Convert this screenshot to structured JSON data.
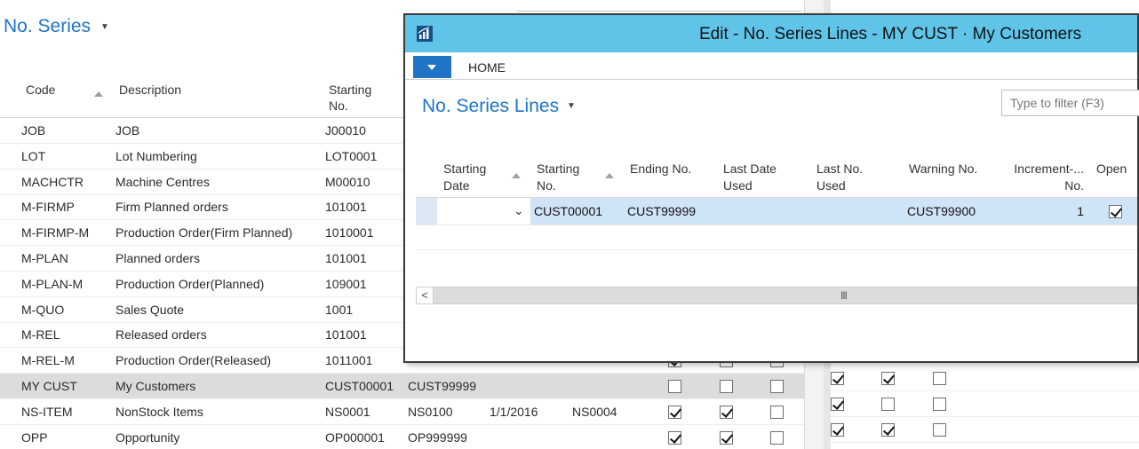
{
  "background_page": {
    "title": "No. Series",
    "columns": {
      "code": "Code",
      "description": "Description",
      "starting_no": "Starting No."
    },
    "rows": [
      {
        "code": "JOB",
        "description": "JOB",
        "starting_no": "J00010",
        "ending_no": "",
        "last_date": "",
        "last_no": "",
        "c1": null,
        "c2": null,
        "c3": null
      },
      {
        "code": "LOT",
        "description": "Lot Numbering",
        "starting_no": "LOT0001",
        "ending_no": "",
        "last_date": "",
        "last_no": "",
        "c1": null,
        "c2": null,
        "c3": null
      },
      {
        "code": "MACHCTR",
        "description": "Machine Centres",
        "starting_no": "M00010",
        "ending_no": "",
        "last_date": "",
        "last_no": "",
        "c1": null,
        "c2": null,
        "c3": null
      },
      {
        "code": "M-FIRMP",
        "description": "Firm Planned orders",
        "starting_no": "101001",
        "ending_no": "",
        "last_date": "",
        "last_no": "",
        "c1": null,
        "c2": null,
        "c3": null
      },
      {
        "code": "M-FIRMP-M",
        "description": "Production Order(Firm Planned)",
        "starting_no": "1010001",
        "ending_no": "",
        "last_date": "",
        "last_no": "",
        "c1": null,
        "c2": null,
        "c3": null
      },
      {
        "code": "M-PLAN",
        "description": "Planned orders",
        "starting_no": "101001",
        "ending_no": "",
        "last_date": "",
        "last_no": "",
        "c1": null,
        "c2": null,
        "c3": null
      },
      {
        "code": "M-PLAN-M",
        "description": "Production Order(Planned)",
        "starting_no": "109001",
        "ending_no": "",
        "last_date": "",
        "last_no": "",
        "c1": null,
        "c2": null,
        "c3": null
      },
      {
        "code": "M-QUO",
        "description": "Sales Quote",
        "starting_no": "1001",
        "ending_no": "",
        "last_date": "",
        "last_no": "",
        "c1": null,
        "c2": null,
        "c3": null
      },
      {
        "code": "M-REL",
        "description": "Released orders",
        "starting_no": "101001",
        "ending_no": "",
        "last_date": "",
        "last_no": "",
        "c1": null,
        "c2": null,
        "c3": null
      },
      {
        "code": "M-REL-M",
        "description": "Production Order(Released)",
        "starting_no": "1011001",
        "ending_no": "",
        "last_date": "",
        "last_no": "",
        "c1": true,
        "c2": false,
        "c3": false
      },
      {
        "code": "MY CUST",
        "description": "My Customers",
        "starting_no": "CUST00001",
        "ending_no": "CUST99999",
        "last_date": "",
        "last_no": "",
        "c1": false,
        "c2": false,
        "c3": false,
        "selected": true
      },
      {
        "code": "NS-ITEM",
        "description": "NonStock Items",
        "starting_no": "NS0001",
        "ending_no": "NS0100",
        "last_date": "1/1/2016",
        "last_no": "NS0004",
        "c1": true,
        "c2": true,
        "c3": false
      },
      {
        "code": "OPP",
        "description": "Opportunity",
        "starting_no": "OP000001",
        "ending_no": "OP999999",
        "last_date": "",
        "last_no": "",
        "c1": true,
        "c2": true,
        "c3": false
      }
    ],
    "right_strip_rows": [
      {
        "c1": true,
        "c2": true,
        "c3": false
      },
      {
        "c1": true,
        "c2": false,
        "c3": false
      },
      {
        "c1": true,
        "c2": true,
        "c3": false
      }
    ]
  },
  "dialog": {
    "title": "Edit - No. Series Lines - MY CUST · My Customers",
    "ribbon_tab": "HOME",
    "page_title": "No. Series Lines",
    "filter_placeholder": "Type to filter (F3)",
    "columns": {
      "starting_date": [
        "Starting",
        "Date"
      ],
      "starting_no": [
        "Starting",
        "No."
      ],
      "ending_no": "Ending No.",
      "last_date_used": [
        "Last Date",
        "Used"
      ],
      "last_no_used": [
        "Last No.",
        "Used"
      ],
      "warning_no": "Warning No.",
      "increment_by_no": [
        "Increment-...",
        "No."
      ],
      "open": "Open"
    },
    "row": {
      "starting_date": "",
      "starting_no": "CUST00001",
      "ending_no": "CUST99999",
      "last_date_used": "",
      "last_no_used": "",
      "warning_no": "CUST99900",
      "increment_by_no": "1",
      "open": true
    },
    "scroll_grip": "III",
    "scroll_left": "<"
  },
  "icons": {
    "app": "dynamics-nav-app-icon",
    "dropdown": "chevron-down-icon"
  },
  "colors": {
    "accent_blue": "#1f74c7",
    "titlebar": "#5fc4e8",
    "row_highlight": "#cfe4f6",
    "row_selected_bg": "#dcdcdc"
  }
}
